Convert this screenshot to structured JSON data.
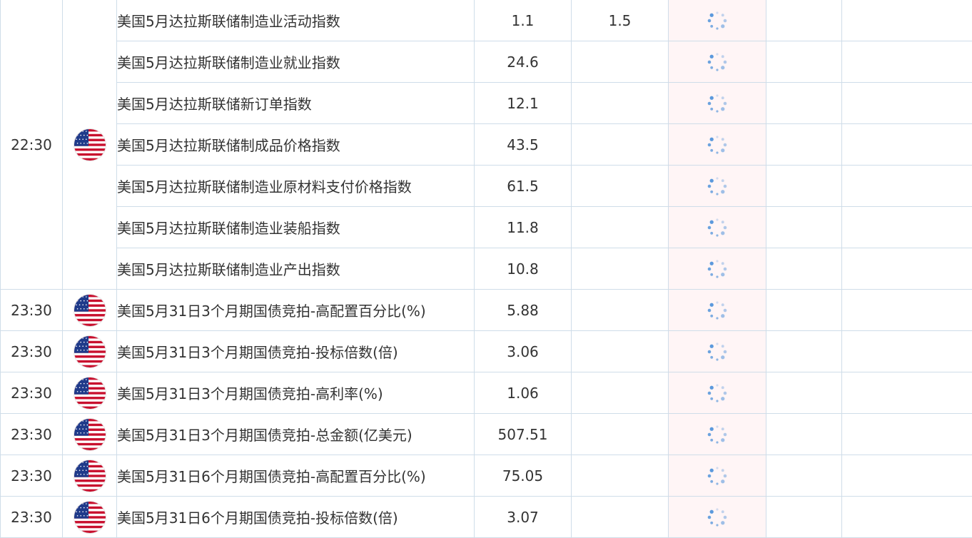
{
  "rows": [
    {
      "time": "22:30",
      "flag": "us-flag-icon",
      "name": "美国5月达拉斯联储制造业活动指数",
      "prev": "1.1",
      "forecast": "1.5"
    },
    {
      "time": "",
      "flag": "",
      "name": "美国5月达拉斯联储制造业就业指数",
      "prev": "24.6",
      "forecast": ""
    },
    {
      "time": "",
      "flag": "",
      "name": "美国5月达拉斯联储新订单指数",
      "prev": "12.1",
      "forecast": ""
    },
    {
      "time": "",
      "flag": "",
      "name": "美国5月达拉斯联储制成品价格指数",
      "prev": "43.5",
      "forecast": ""
    },
    {
      "time": "",
      "flag": "",
      "name": "美国5月达拉斯联储制造业原材料支付价格指数",
      "prev": "61.5",
      "forecast": ""
    },
    {
      "time": "",
      "flag": "",
      "name": "美国5月达拉斯联储制造业装船指数",
      "prev": "11.8",
      "forecast": ""
    },
    {
      "time": "",
      "flag": "",
      "name": "美国5月达拉斯联储制造业产出指数",
      "prev": "10.8",
      "forecast": ""
    },
    {
      "time": "23:30",
      "flag": "us-flag-icon",
      "name": "美国5月31日3个月期国债竞拍-高配置百分比(%)",
      "prev": "5.88",
      "forecast": ""
    },
    {
      "time": "23:30",
      "flag": "us-flag-icon",
      "name": "美国5月31日3个月期国债竞拍-投标倍数(倍)",
      "prev": "3.06",
      "forecast": ""
    },
    {
      "time": "23:30",
      "flag": "us-flag-icon",
      "name": "美国5月31日3个月期国债竞拍-高利率(%)",
      "prev": "1.06",
      "forecast": ""
    },
    {
      "time": "23:30",
      "flag": "us-flag-icon",
      "name": "美国5月31日3个月期国债竞拍-总金额(亿美元)",
      "prev": "507.51",
      "forecast": ""
    },
    {
      "time": "23:30",
      "flag": "us-flag-icon",
      "name": "美国5月31日6个月期国债竞拍-高配置百分比(%)",
      "prev": "75.05",
      "forecast": ""
    },
    {
      "time": "23:30",
      "flag": "us-flag-icon",
      "name": "美国5月31日6个月期国债竞拍-投标倍数(倍)",
      "prev": "3.07",
      "forecast": ""
    }
  ],
  "colors": {
    "grid": "#cfdde9",
    "actual_bg": "#fff5f6",
    "spinner": "#4a90d9",
    "flag_red": "#c8102e",
    "flag_blue": "#1f3a8a"
  },
  "icons": {
    "actual_loading": "loading-spinner-icon",
    "country": "us-flag-icon"
  }
}
